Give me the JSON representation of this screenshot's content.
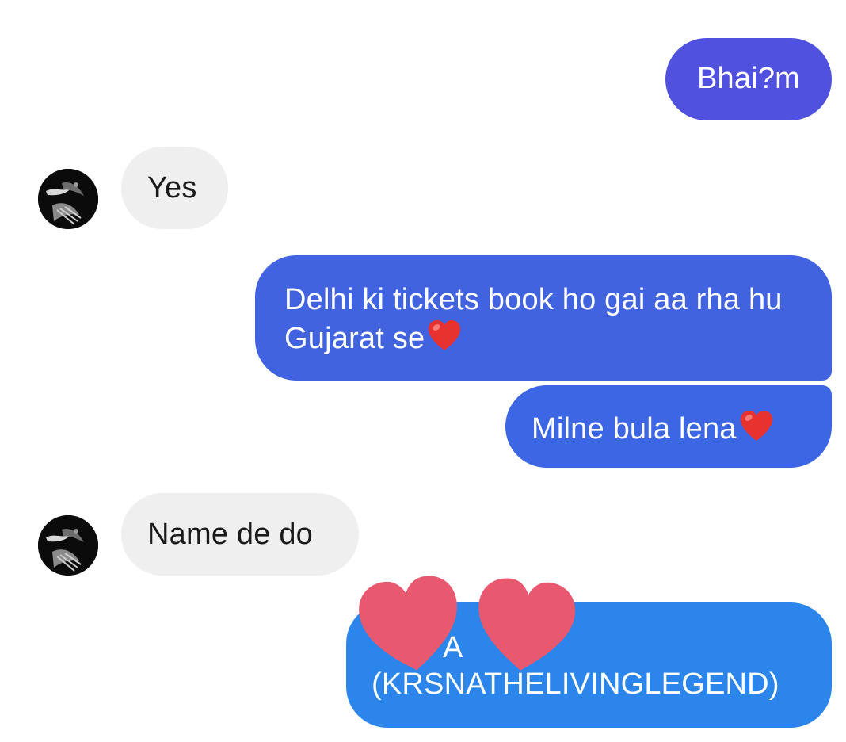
{
  "conversation": {
    "messages": [
      {
        "direction": "sent",
        "text": "Bhai?m"
      },
      {
        "direction": "received",
        "text": "Yes"
      },
      {
        "direction": "sent",
        "text": "Delhi ki tickets book ho gai aa rha hu Gujarat se",
        "emoji": "red-heart"
      },
      {
        "direction": "sent",
        "text": "Milne bula lena",
        "emoji": "red-heart"
      },
      {
        "direction": "received",
        "text": "Name de do"
      },
      {
        "direction": "sent",
        "visible_fragment": "A",
        "text": "(KRSNATHELIVINGLEGEND)",
        "redacted_by": "pink-heart-stickers"
      }
    ]
  },
  "colors": {
    "sent_bubble_1": "#5151e0",
    "sent_bubble_3": "#4163df",
    "sent_bubble_4": "#3d66e4",
    "sent_bubble_6": "#2b85ea",
    "received_bubble": "#efefef",
    "redaction_heart": "#e8596f",
    "emoji_heart": "#e8322f"
  }
}
